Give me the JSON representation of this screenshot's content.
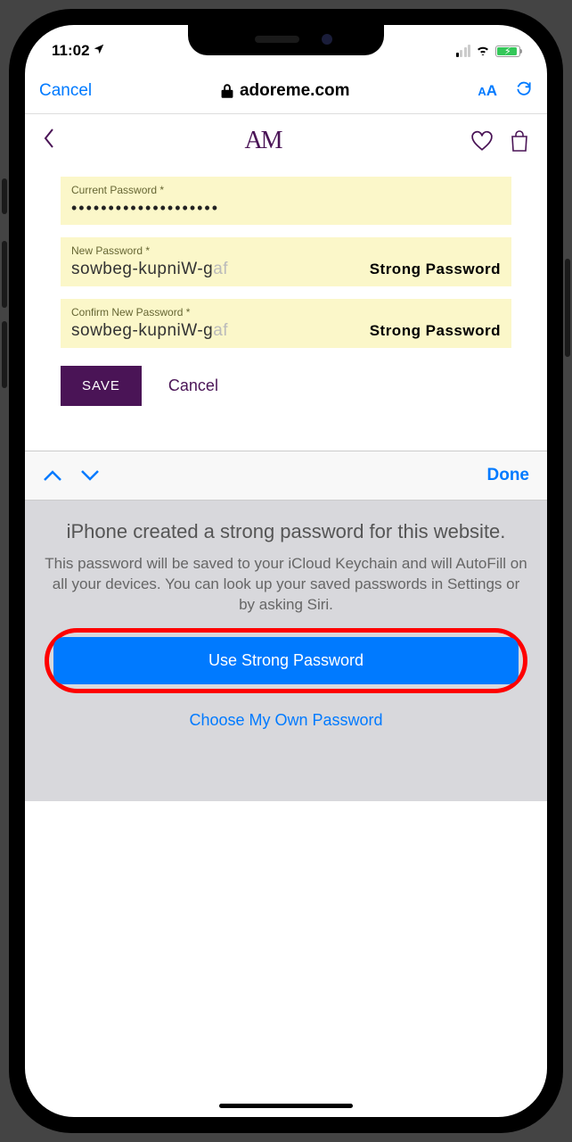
{
  "status": {
    "time": "11:02",
    "location_arrow": "➤"
  },
  "safari": {
    "cancel": "Cancel",
    "domain": "adoreme.com",
    "aa": "A"
  },
  "brand": {
    "logo": "AM"
  },
  "form": {
    "current_label": "Current Password *",
    "current_value": "••••••••••••••••••••",
    "new_label": "New Password *",
    "new_value_visible": "sowbeg-kupniW-g",
    "new_value_fade": "af",
    "strong_badge": "Strong Password",
    "confirm_label": "Confirm New Password *",
    "confirm_value_visible": "sowbeg-kupniW-g",
    "confirm_value_fade": "af",
    "save": "SAVE",
    "cancel": "Cancel"
  },
  "accessory": {
    "done": "Done"
  },
  "sheet": {
    "title": "iPhone created a strong password for this website.",
    "subtitle": "This password will be saved to your iCloud Keychain and will AutoFill on all your devices. You can look up your saved passwords in Settings or by asking Siri.",
    "use_strong": "Use Strong Password",
    "choose_own": "Choose My Own Password"
  }
}
